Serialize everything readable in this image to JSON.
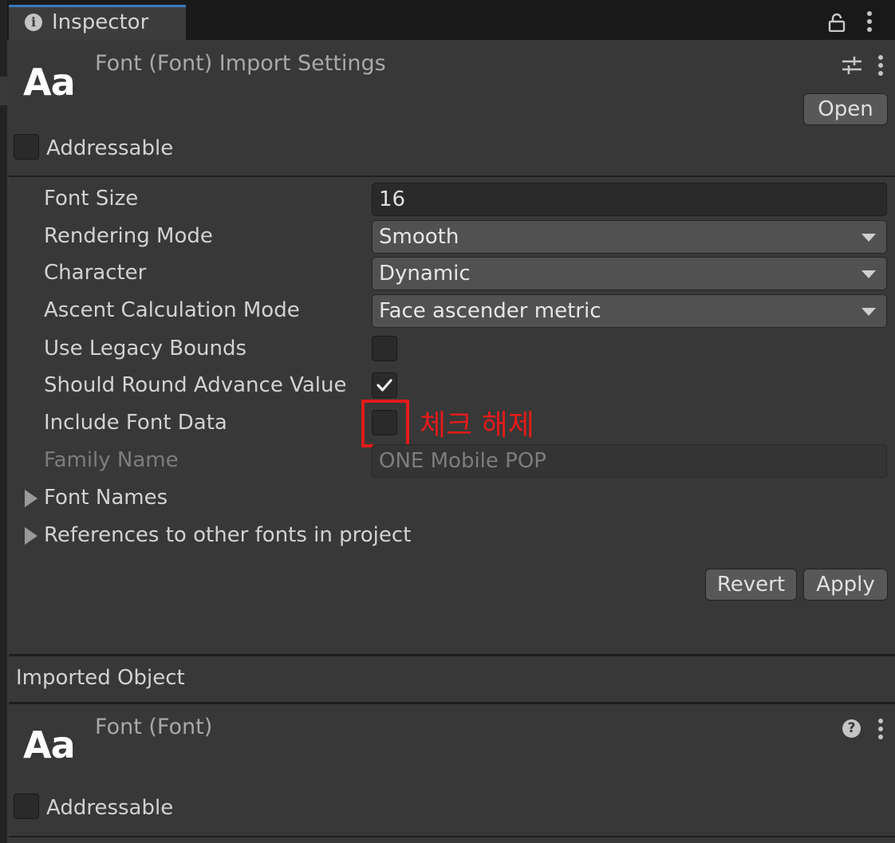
{
  "tab": {
    "title": "Inspector",
    "icons": [
      "info-icon",
      "lock-icon",
      "kebab-menu-icon"
    ]
  },
  "import_header": {
    "icon_text": "Aa",
    "title": "Font (Font) Import Settings",
    "icons": [
      "preset-sliders-icon",
      "kebab-menu-icon"
    ],
    "open_label": "Open",
    "addressable_label": "Addressable",
    "addressable_checked": false
  },
  "fields": {
    "font_size": {
      "label": "Font Size",
      "value": "16"
    },
    "rendering_mode": {
      "label": "Rendering Mode",
      "value": "Smooth"
    },
    "character": {
      "label": "Character",
      "value": "Dynamic"
    },
    "ascent_mode": {
      "label": "Ascent Calculation Mode",
      "value": "Face ascender metric"
    },
    "legacy_bounds": {
      "label": "Use Legacy Bounds",
      "checked": false
    },
    "round_advance": {
      "label": "Should Round Advance Value",
      "checked": true
    },
    "include_font_data": {
      "label": "Include Font Data",
      "checked": false
    },
    "family_name": {
      "label": "Family Name",
      "placeholder": "ONE Mobile POP"
    }
  },
  "annotation": {
    "text": "체크 해제",
    "color": "#e21b1b"
  },
  "foldouts": {
    "font_names": "Font Names",
    "references": "References to other fonts in project"
  },
  "actions": {
    "revert_label": "Revert",
    "apply_label": "Apply"
  },
  "imported_object": {
    "heading": "Imported Object",
    "icon_text": "Aa",
    "title": "Font (Font)",
    "icons": [
      "help-icon",
      "kebab-menu-icon"
    ],
    "addressable_label": "Addressable",
    "addressable_checked": false
  }
}
